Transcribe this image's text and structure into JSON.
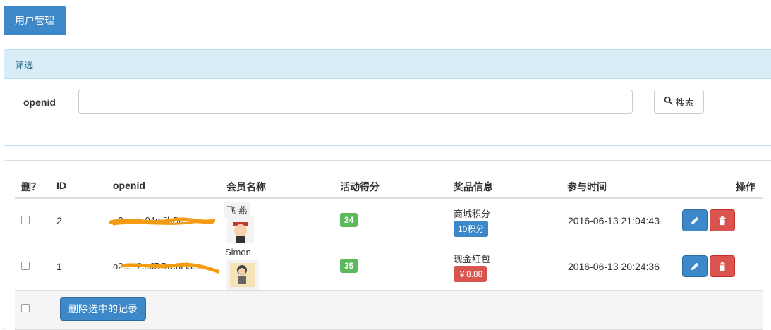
{
  "tabs": [
    {
      "label": "用户管理"
    }
  ],
  "filter": {
    "title": "筛选",
    "openid_label": "openid",
    "openid_value": "",
    "search_button": "搜索"
  },
  "table": {
    "headers": {
      "delete": "删？",
      "id": "ID",
      "openid": "openid",
      "member_name": "会员名称",
      "activity_score": "活动得分",
      "prize_info": "奖品信息",
      "join_time": "参与时间",
      "actions": "操作"
    },
    "rows": [
      {
        "id": "2",
        "openid": "o2...--b-04mJbSo...",
        "member_name": "飞 燕",
        "score": "24",
        "prize_type": "商城积分",
        "prize_value": "10积分",
        "join_time": "2016-06-13 21:04:43"
      },
      {
        "id": "1",
        "openid": "o2...--2...JDDrenLis...",
        "member_name": "Simon",
        "score": "35",
        "prize_type": "现金红包",
        "prize_value": "￥8.88",
        "join_time": "2016-06-13 20:24:36"
      }
    ],
    "delete_selected_button": "删除选中的记录"
  },
  "colors": {
    "primary": "#3d88c8",
    "success": "#5cb85c",
    "danger": "#d9534f",
    "info_bg": "#d9edf7",
    "redaction": "#f39c12"
  }
}
